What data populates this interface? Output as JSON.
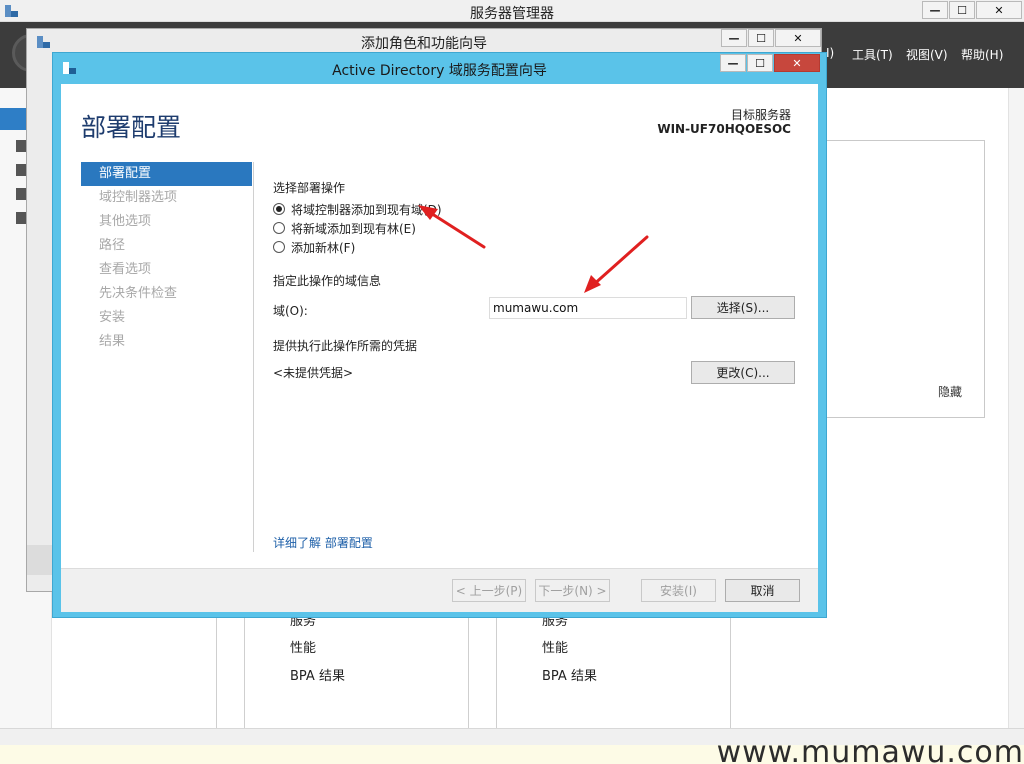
{
  "server_manager": {
    "title": "服务器管理器",
    "menu": [
      {
        "label": "I)"
      },
      {
        "label": "工具(T)"
      },
      {
        "label": "视图(V)"
      },
      {
        "label": "帮助(H)"
      }
    ],
    "hide_label": "隐藏",
    "tiles": [
      {
        "items": [
          "服务",
          "性能",
          "BPA 结果"
        ]
      },
      {
        "items": [
          "服务",
          "性能",
          "BPA 结果"
        ]
      }
    ]
  },
  "add_roles_wizard": {
    "title": "添加角色和功能向导"
  },
  "window_controls": {
    "minimize": "—",
    "maximize": "☐",
    "close": "✕"
  },
  "ad_wizard": {
    "title": "Active Directory 域服务配置向导",
    "page_title": "部署配置",
    "target_server_label": "目标服务器",
    "target_server_name": "WIN-UF70HQOESOC",
    "nav": [
      {
        "label": "部署配置",
        "active": true
      },
      {
        "label": "域控制器选项",
        "active": false
      },
      {
        "label": "其他选项",
        "active": false
      },
      {
        "label": "路径",
        "active": false
      },
      {
        "label": "查看选项",
        "active": false
      },
      {
        "label": "先决条件检查",
        "active": false
      },
      {
        "label": "安装",
        "active": false
      },
      {
        "label": "结果",
        "active": false
      }
    ],
    "select_operation_label": "选择部署操作",
    "options": [
      {
        "label": "将域控制器添加到现有域(D)",
        "selected": true
      },
      {
        "label": "将新域添加到现有林(E)",
        "selected": false
      },
      {
        "label": "添加新林(F)",
        "selected": false
      }
    ],
    "domain_info_label": "指定此操作的域信息",
    "domain_field_label": "域(O):",
    "domain_value": "mumawu.com",
    "select_button": "选择(S)...",
    "credentials_label": "提供执行此操作所需的凭据",
    "credentials_value": "<未提供凭据>",
    "change_button": "更改(C)...",
    "learn_more_link": "详细了解 部署配置",
    "footer": {
      "prev": "< 上一步(P)",
      "next": "下一步(N) >",
      "install": "安装(I)",
      "cancel": "取消"
    }
  },
  "watermark": "www.mumawu.com",
  "colors": {
    "wizard_frame": "#5ac3e9",
    "nav_active": "#2a78bf",
    "page_title": "#1e3c6e",
    "link": "#1d5fa8",
    "annotation_arrow": "#e02020"
  }
}
